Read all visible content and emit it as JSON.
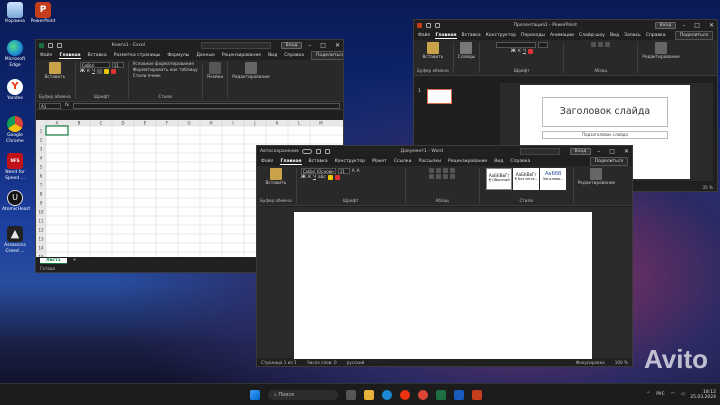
{
  "desktop_icons": [
    {
      "label": "Корзина",
      "icon": "recycle-bin-icon"
    },
    {
      "label": "PowerPoint",
      "icon": "powerpoint-icon"
    },
    {
      "label": "Microsoft Edge",
      "icon": "edge-icon"
    },
    {
      "label": "Yandex",
      "icon": "yandex-icon"
    },
    {
      "label": "Google Chrome",
      "icon": "chrome-icon"
    },
    {
      "label": "Need for Speed ...",
      "icon": "nfs-icon"
    },
    {
      "label": "AtomicHeart",
      "icon": "unreal-icon"
    },
    {
      "label": "Assassins Creed ...",
      "icon": "assassins-icon"
    }
  ],
  "excel": {
    "title": "Книга1 - Excel",
    "signin": "Вход",
    "tabs": [
      "Файл",
      "Главная",
      "Вставка",
      "Разметка страницы",
      "Формулы",
      "Данные",
      "Рецензирование",
      "Вид",
      "Справка"
    ],
    "share": "Поделиться",
    "ribbon": {
      "paste": "Вставить",
      "clipboard": "Буфер обмена",
      "font_name": "Calibri",
      "font_size": "11",
      "font_group": "Шрифт",
      "cond_format": "Условное форматирование",
      "format_table": "Форматировать как таблицу",
      "cell_styles": "Стили ячеек",
      "styles_group": "Стили",
      "editing": "Редактирование",
      "cells": "Ячейки"
    },
    "name_box": "A1",
    "fx": "fx",
    "columns": [
      "A",
      "B",
      "C",
      "D",
      "E",
      "F",
      "G",
      "H",
      "I",
      "J",
      "K",
      "L",
      "M"
    ],
    "rows": [
      "1",
      "2",
      "3",
      "4",
      "5",
      "6",
      "7",
      "8",
      "9",
      "10",
      "11",
      "12",
      "13",
      "14",
      "15",
      "16",
      "17"
    ],
    "sheet_tab": "Лист1",
    "add_sheet": "+",
    "status": "Готово"
  },
  "powerpoint": {
    "title": "Презентация1 - PowerPoint",
    "signin": "Вход",
    "tabs": [
      "Файл",
      "Главная",
      "Вставка",
      "Конструктор",
      "Переходы",
      "Анимации",
      "Слайд-шоу",
      "Вид",
      "Запись",
      "Справка"
    ],
    "share": "Поделиться",
    "ribbon": {
      "paste": "Вставить",
      "clipboard": "Буфер обмена",
      "slides": "Слайды",
      "font_group": "Шрифт",
      "paragraph": "Абзац",
      "editing": "Редактирование"
    },
    "slide_number": "1",
    "slide_title": "Заголовок слайда",
    "slide_subtitle": "Подзаголовок слайда",
    "zoom": "35 %"
  },
  "word": {
    "title": "Документ1 - Word",
    "autosave": "Автосохранение",
    "signin": "Вход",
    "tabs": [
      "Файл",
      "Главная",
      "Вставка",
      "Конструктор",
      "Макет",
      "Ссылки",
      "Рассылки",
      "Рецензирование",
      "Вид",
      "Справка"
    ],
    "share": "Поделиться",
    "ribbon": {
      "paste": "Вставить",
      "clipboard": "Буфер обмена",
      "font_name": "Calibri (Основн",
      "font_size": "11",
      "font_group": "Шрифт",
      "paragraph": "Абзац",
      "styles_group": "Стили",
      "styles": [
        {
          "sample": "АаБбВвГг",
          "name": "¶ Обычный"
        },
        {
          "sample": "АаБбВвГг",
          "name": "¶ Без инте..."
        },
        {
          "sample": "АаБбВ",
          "name": "Заголово..."
        }
      ],
      "editing": "Редактирование"
    },
    "status": {
      "page": "Страница 1 из 1",
      "words": "Число слов: 0",
      "lang": "русский",
      "focus": "Фокусировка",
      "zoom": "100 %"
    }
  },
  "taskbar": {
    "search": "Поиск",
    "lang": "РУС",
    "time": "18:12",
    "date": "25.03.2024"
  },
  "watermark": "Avito"
}
